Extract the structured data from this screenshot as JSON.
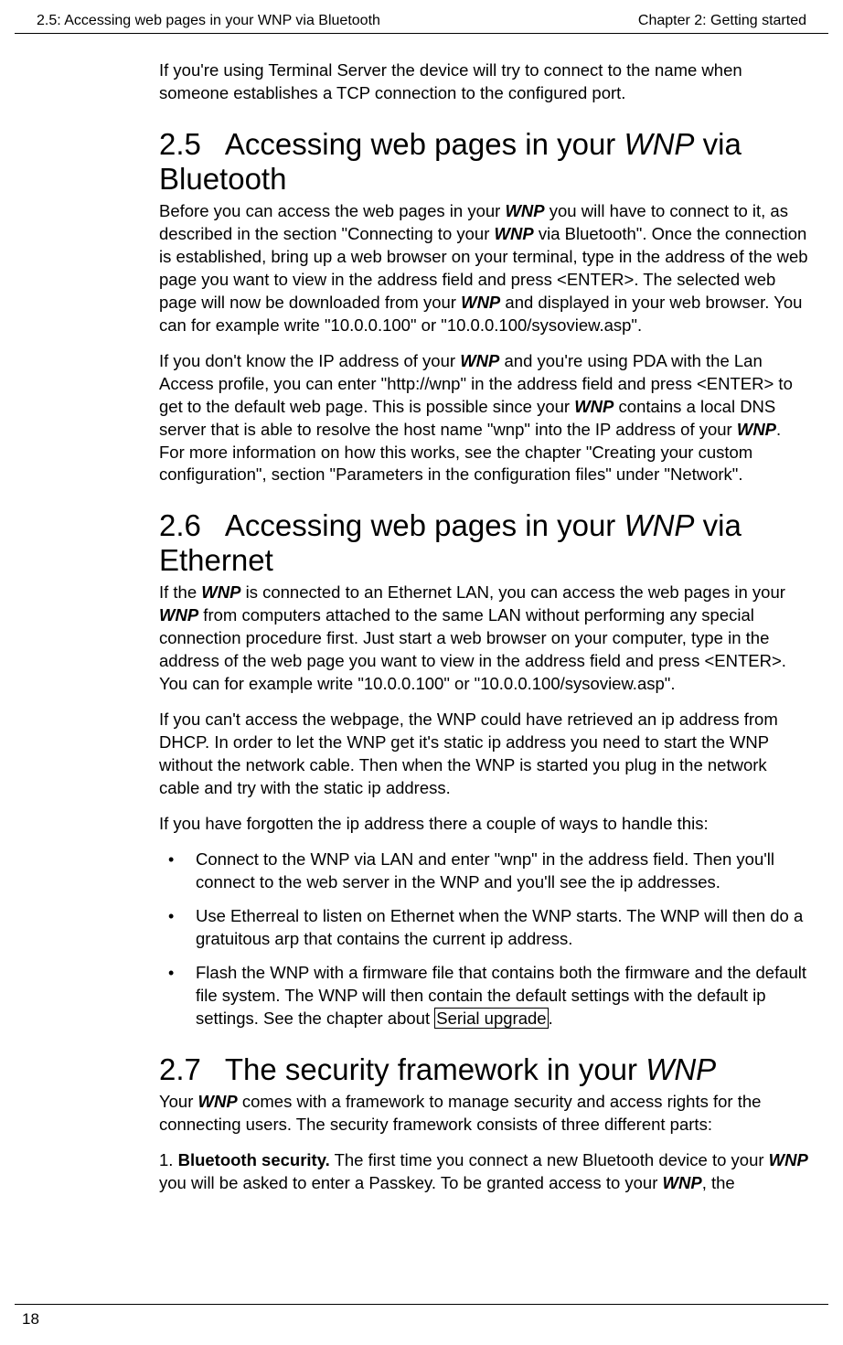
{
  "header": {
    "left": "2.5: Accessing web pages in your WNP via Bluetooth",
    "right": "Chapter 2: Getting started"
  },
  "intro_p": "If you're using Terminal Server the device will try to connect to the name when someone establishes a TCP connection to the configured port.",
  "s25": {
    "num": "2.5",
    "title_a": "Accessing web pages in your ",
    "title_i": "WNP",
    "title_b": " via Bluetooth",
    "p1_a": "Before you can access the web pages in your ",
    "p1_b": "WNP",
    "p1_c": " you will have to connect to it, as described in the section \"Connecting to your ",
    "p1_d": "WNP",
    "p1_e": " via Bluetooth\". Once the connection is established, bring up a web browser on your terminal, type in the address of the web page you want to view in the address field and press <ENTER>. The selected web page will now be downloaded from your ",
    "p1_f": "WNP",
    "p1_g": " and displayed in your web browser. You can for example write \"10.0.0.100\" or \"10.0.0.100/sysoview.asp\".",
    "p2_a": "If you don't know the IP address of your ",
    "p2_b": "WNP",
    "p2_c": " and you're using PDA with the Lan Access profile, you can enter \"http://wnp\" in the address field and press <ENTER> to get to the default web page. This is possible since your ",
    "p2_d": "WNP",
    "p2_e": " contains a local DNS server that is able to resolve the host name \"wnp\" into the IP address of your ",
    "p2_f": "WNP",
    "p2_g": ". For more information on how this works, see the chapter \"Creating your custom configuration\", section \"Parameters in the configuration files\" under \"Network\"."
  },
  "s26": {
    "num": "2.6",
    "title_a": "Accessing web pages in your ",
    "title_i": "WNP",
    "title_b": " via Ethernet",
    "p1_a": "If the ",
    "p1_b": "WNP",
    "p1_c": " is connected to an Ethernet LAN, you can access the web pages in your ",
    "p1_d": "WNP",
    "p1_e": " from computers attached to the same LAN without performing any special connection procedure first. Just start a web browser on your computer, type in the address of the web page you want to view in the address field and press <ENTER>. You can for example write \"10.0.0.100\" or \"10.0.0.100/sysoview.asp\".",
    "p2": "If you can't access the webpage, the WNP could have retrieved an ip address from DHCP. In order to let the WNP get it's static ip address you need to start the WNP without the network cable. Then when the WNP is started you plug in the network cable and try with the static ip address.",
    "p3": "If you have forgotten the ip address there a couple of ways to handle this:",
    "li1": "Connect to the WNP via LAN and enter \"wnp\" in the address field. Then you'll connect to the web server in the WNP and you'll see the ip addresses.",
    "li2": "Use Etherreal to listen on Ethernet when the WNP starts. The WNP will then do a gratuitous arp that contains the current ip address.",
    "li3_a": "Flash the WNP with a firmware file that contains both the firmware and the default file system. The WNP will then contain the default settings with the default ip settings. See the chapter about ",
    "li3_link": "Serial upgrade",
    "li3_b": "."
  },
  "s27": {
    "num": "2.7",
    "title_a": "The security framework in your ",
    "title_i": "WNP",
    "p1_a": "Your ",
    "p1_b": "WNP",
    "p1_c": " comes with a framework to manage security and access rights for the connecting users. The security framework consists of three different parts:",
    "p2_a": "1. ",
    "p2_b": "Bluetooth security.",
    "p2_c": " The first time you connect a new Bluetooth device to your ",
    "p2_d": "WNP",
    "p2_e": " you will be asked to enter a Passkey. To be granted access to your ",
    "p2_f": "WNP",
    "p2_g": ", the"
  },
  "footer": {
    "page": "18"
  }
}
